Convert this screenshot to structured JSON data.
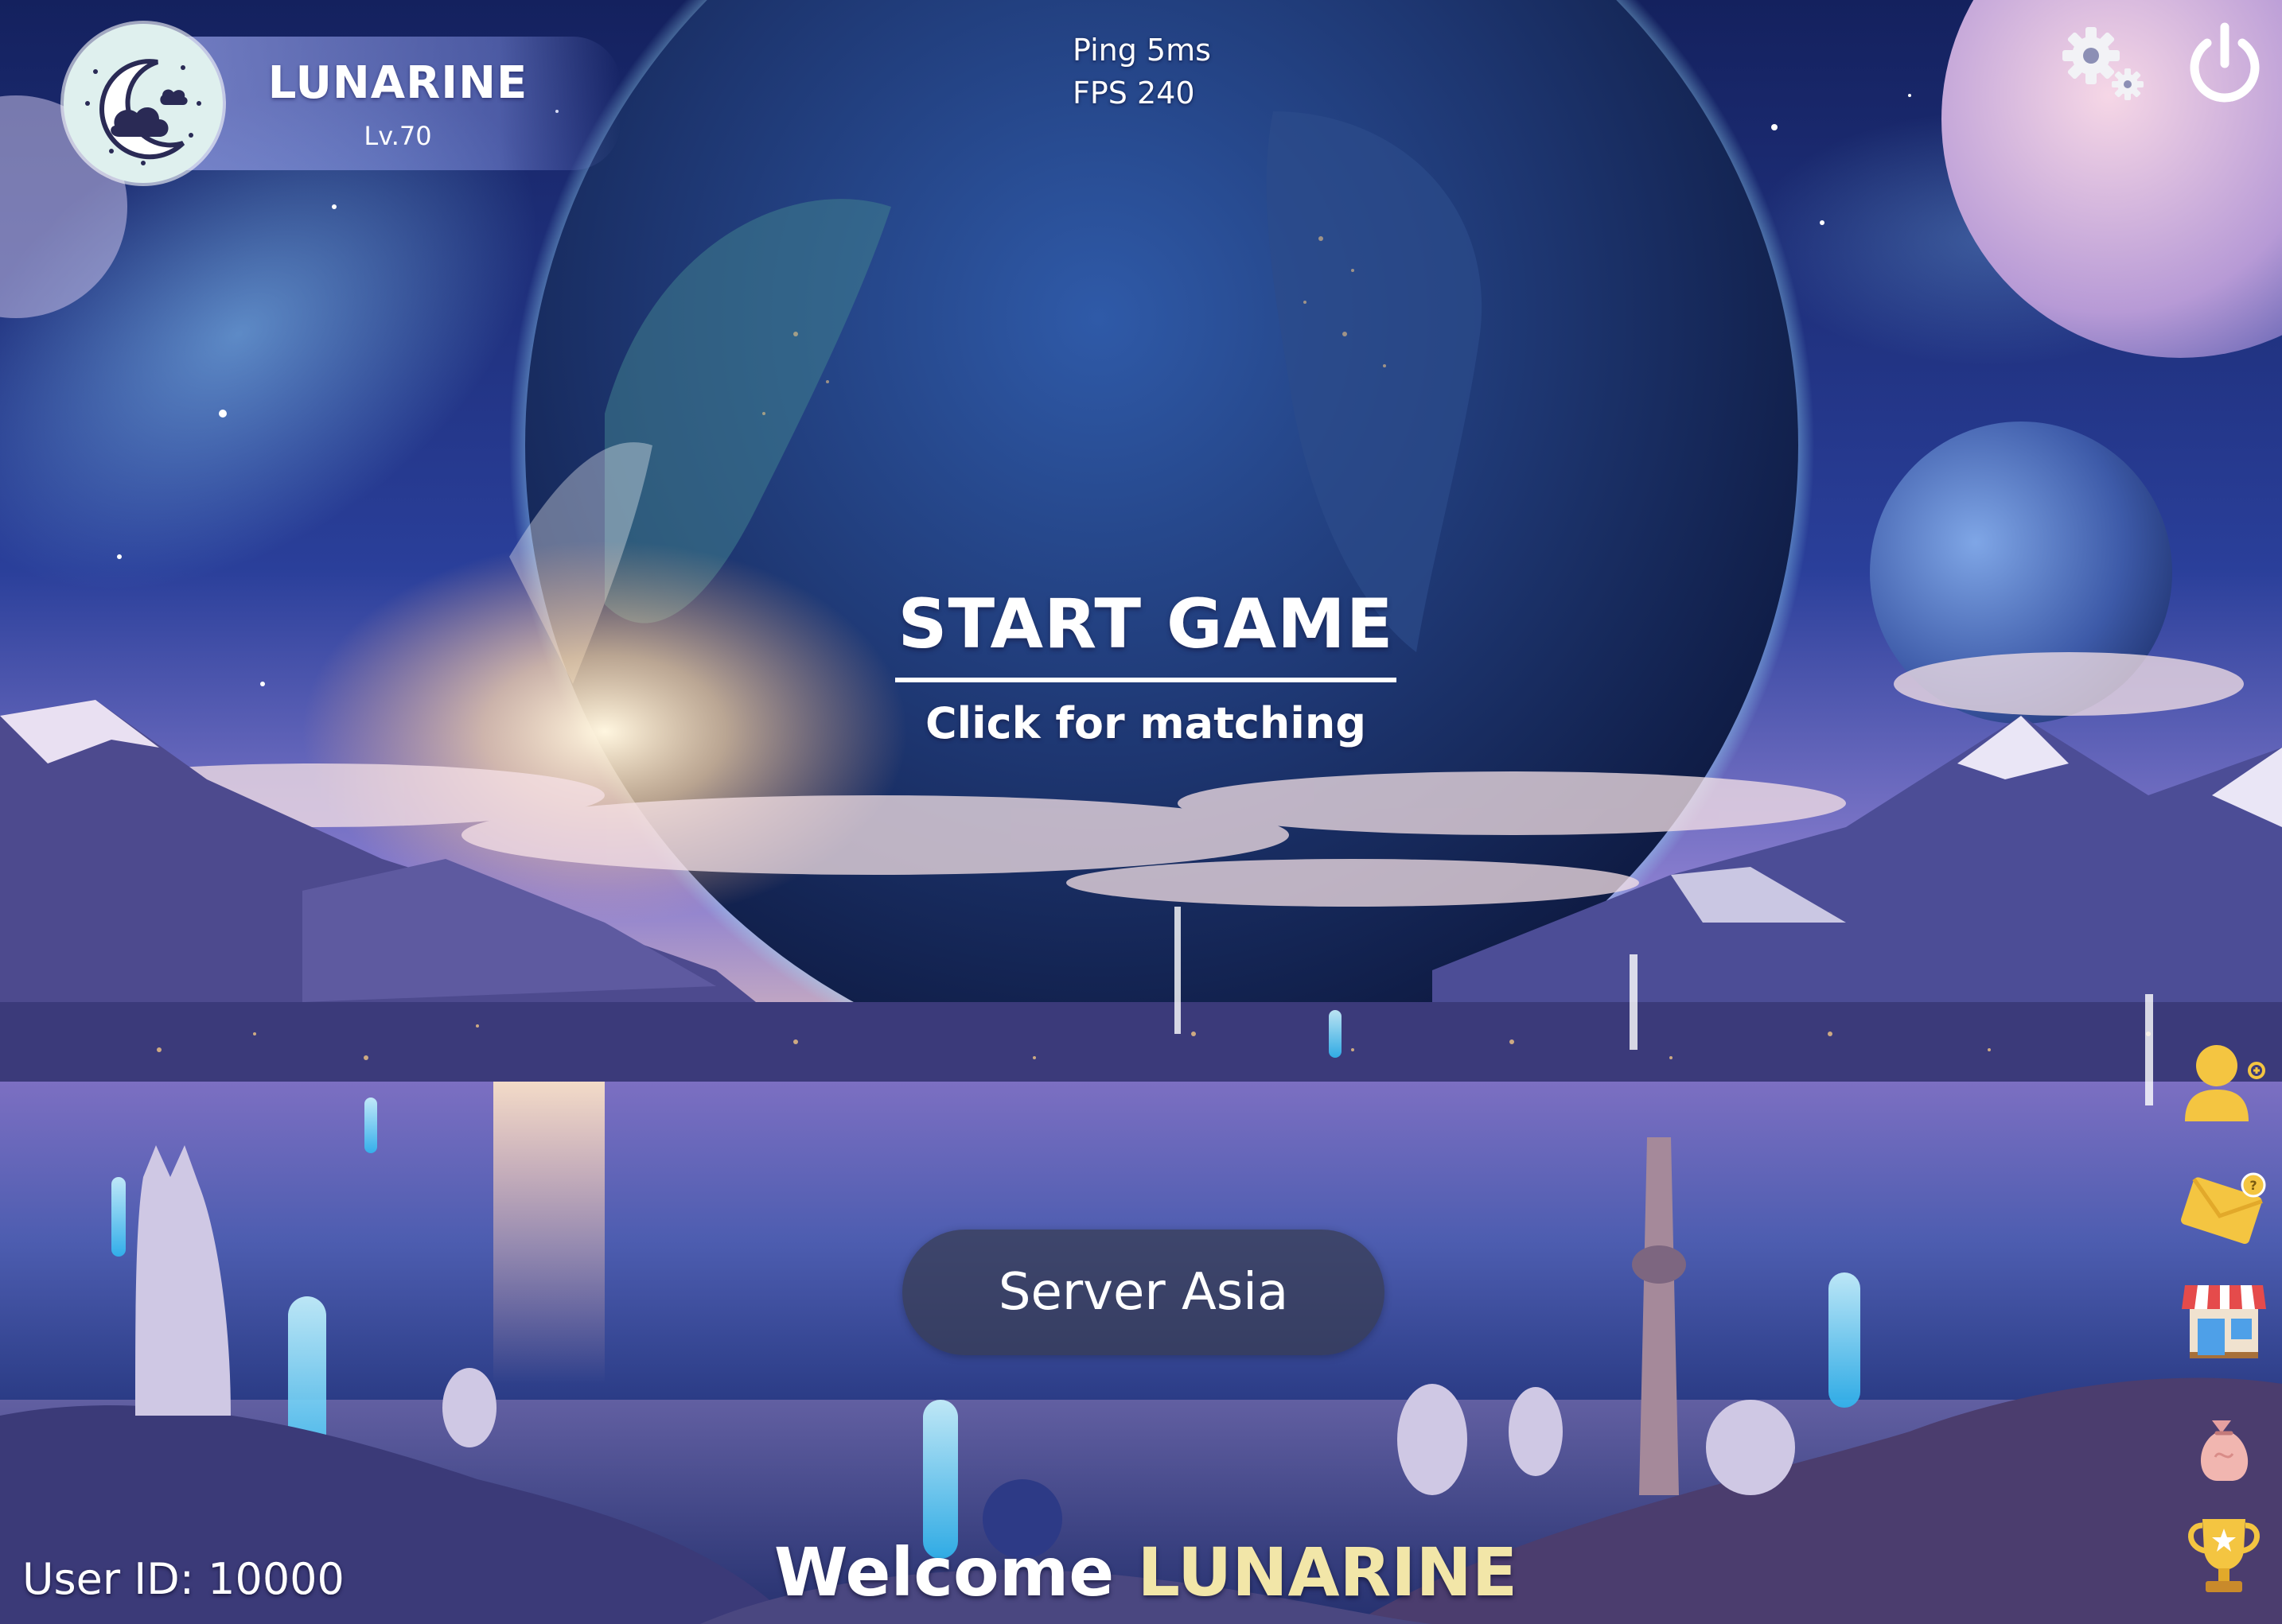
{
  "profile": {
    "name": "LUNARINE",
    "level": "Lv.70"
  },
  "stats": {
    "ping": "Ping 5ms",
    "fps": "FPS 240"
  },
  "start": {
    "title": "START GAME",
    "subtitle": "Click for matching"
  },
  "server": {
    "label": "Server Asia"
  },
  "footer": {
    "user_id": "User ID: 10000",
    "welcome_prefix": "Welcome",
    "welcome_name": "LUNARINE"
  },
  "side_menu": [
    "friends-icon",
    "mail-icon",
    "shop-icon",
    "bag-icon",
    "trophy-icon"
  ],
  "colors": {
    "accent_gold": "#f2e6a8",
    "icon_gold": "#f4c541",
    "profile_plate": "#8e98dd",
    "server_button": "#373c50"
  }
}
